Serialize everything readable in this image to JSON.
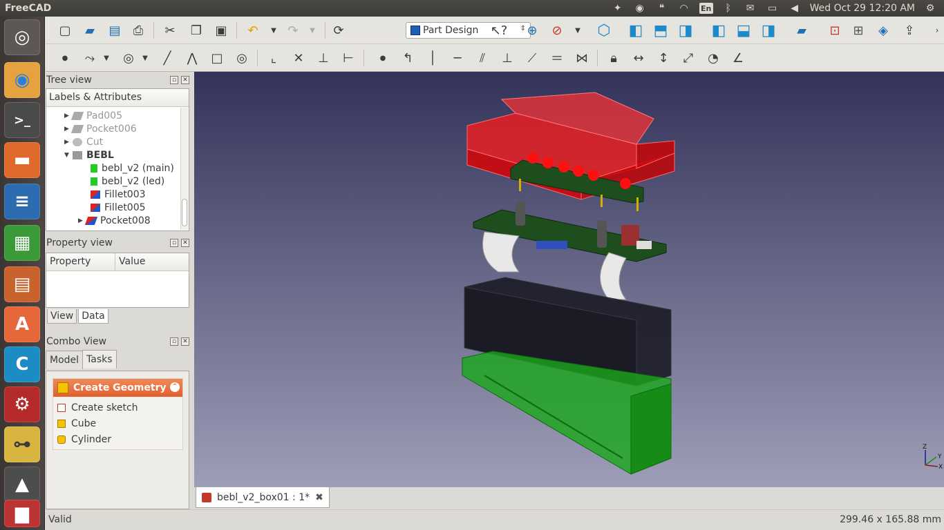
{
  "panel": {
    "app_name": "FreeCAD",
    "keyboard_layout": "En",
    "clock": "Wed Oct 29 12:20 AM",
    "tray_icons": [
      "dropbox-icon",
      "chrome-icon",
      "hangouts-icon",
      "wifi-icon",
      "keyboard-icon",
      "bluetooth-icon",
      "mail-icon",
      "battery-icon",
      "volume-icon",
      "settings-gear-icon"
    ]
  },
  "launcher": {
    "items": [
      "ubuntu-dash",
      "chrome",
      "terminal",
      "files",
      "libreoffice-writer",
      "libreoffice-calc",
      "libreoffice-impress",
      "software-center",
      "cura",
      "freecad",
      "kicad",
      "inkscape",
      "trash"
    ]
  },
  "toolbar": {
    "workbench": "Part Design"
  },
  "tree_view": {
    "title": "Tree view",
    "header": "Labels & Attributes",
    "rows": [
      {
        "label": "Pad005",
        "state": "dim"
      },
      {
        "label": "Pocket006",
        "state": "dim"
      },
      {
        "label": "Cut",
        "state": "dim"
      },
      {
        "label": "BEBL",
        "state": "bold"
      },
      {
        "label": "bebl_v2 (main)",
        "state": "normal"
      },
      {
        "label": "bebl_v2 (led)",
        "state": "normal"
      },
      {
        "label": "Fillet003",
        "state": "normal"
      },
      {
        "label": "Fillet005",
        "state": "normal"
      },
      {
        "label": "Pocket008",
        "state": "normal"
      }
    ]
  },
  "property_view": {
    "title": "Property view",
    "col_property": "Property",
    "col_value": "Value",
    "tab_view": "View",
    "tab_data": "Data"
  },
  "combo_view": {
    "title": "Combo View",
    "tab_model": "Model",
    "tab_tasks": "Tasks",
    "task_panel_title": "Create Geometry",
    "task_items": [
      "Create sketch",
      "Cube",
      "Cylinder"
    ]
  },
  "document_tab": {
    "label": "bebl_v2_box01 : 1*"
  },
  "status": {
    "left": "Valid",
    "right": "299.46 x 165.88 mm"
  },
  "axis_labels": [
    "Z",
    "Y",
    "X"
  ],
  "colors": {
    "case_top": "#ff0000",
    "case_middle": "#1a1a1a",
    "case_bottom": "#22aa22",
    "pcb": "#1e4d1e",
    "task_header": "#e0602d"
  }
}
